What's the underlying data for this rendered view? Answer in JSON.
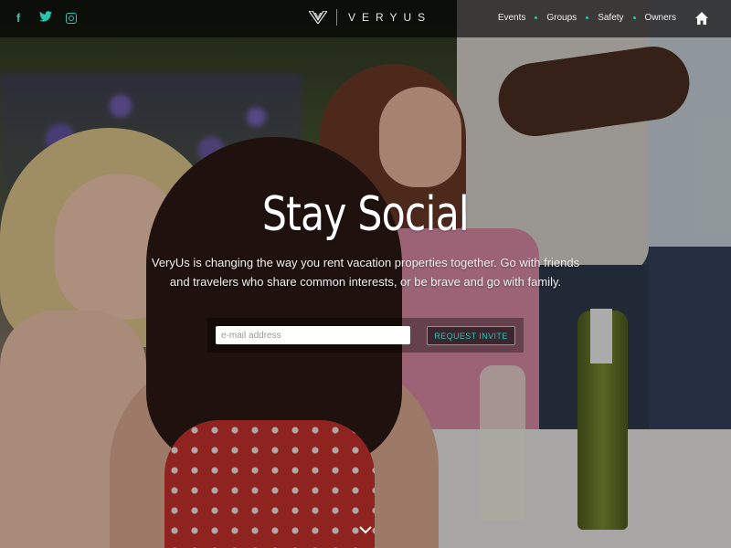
{
  "nav": {
    "brand": "VERYUS",
    "links": [
      "Events",
      "Groups",
      "Safety",
      "Owners"
    ]
  },
  "social": {
    "facebook_glyph": "f",
    "twitter_glyph": "🐦"
  },
  "hero": {
    "title": "Stay Social",
    "subtitle": "VeryUs is changing the way you rent vacation properties together. Go with friends and travelers who share common interests, or be brave and go with family."
  },
  "signup": {
    "email_placeholder": "e-mail address",
    "button_label": "REQUEST INVITE"
  },
  "colors": {
    "accent": "#29c3b0",
    "topbar": "#000000"
  },
  "icons": [
    "facebook-icon",
    "twitter-icon",
    "instagram-icon",
    "veryus-logo-icon",
    "home-icon",
    "chevron-down-icon"
  ]
}
